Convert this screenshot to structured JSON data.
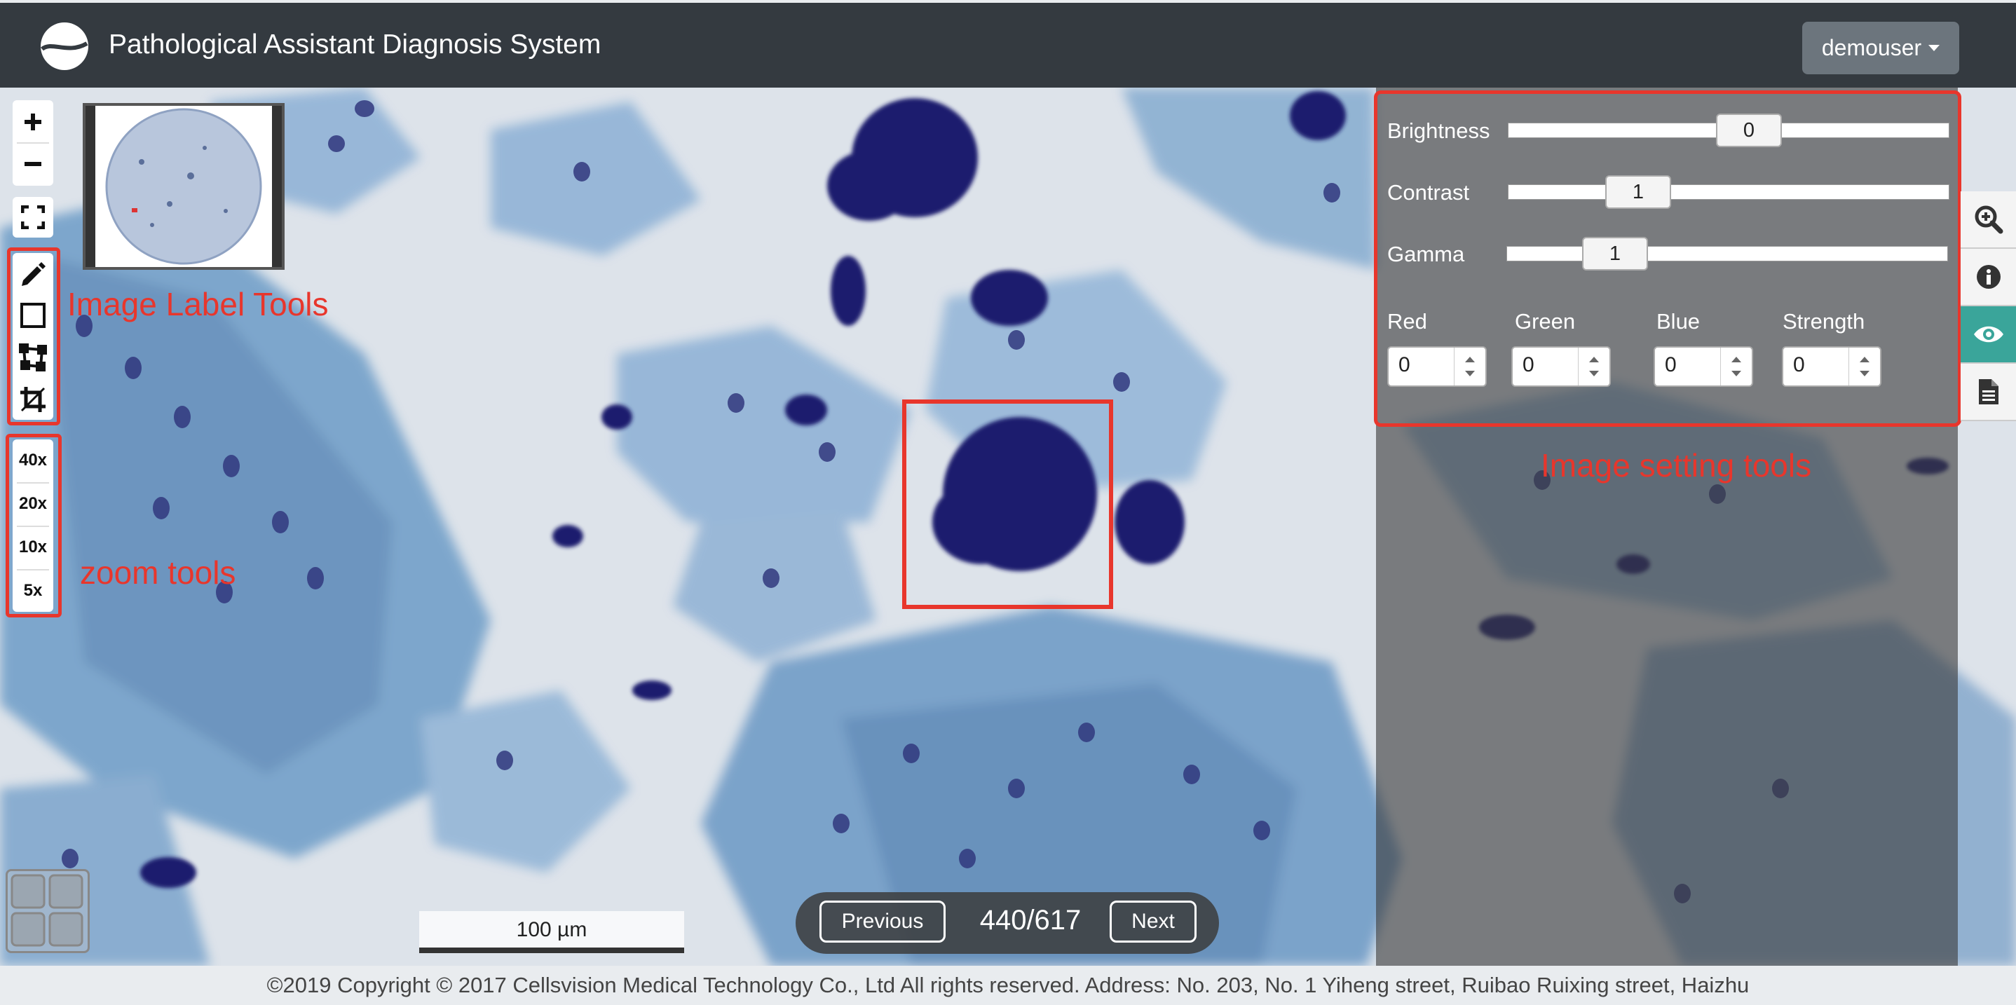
{
  "header": {
    "app_title": "Pathological Assistant Diagnosis System",
    "user_menu_label": "demouser"
  },
  "toolbar": {
    "zoom_in_icon": "plus-icon",
    "zoom_out_icon": "minus-icon",
    "fullscreen_icon": "fullscreen-icon",
    "label_tools": [
      "pencil-icon",
      "rectangle-icon",
      "polygon-icon",
      "crop-icon"
    ],
    "zoom_levels": [
      "40x",
      "20x",
      "10x",
      "5x"
    ]
  },
  "annotations": {
    "label_tools": "Image Label Tools",
    "zoom_tools": "zoom tools",
    "setting_tools": "Image setting tools"
  },
  "settings": {
    "brightness": {
      "label": "Brightness",
      "value": "0"
    },
    "contrast": {
      "label": "Contrast",
      "value": "1"
    },
    "gamma": {
      "label": "Gamma",
      "value": "1"
    },
    "red": {
      "label": "Red",
      "value": "0"
    },
    "green": {
      "label": "Green",
      "value": "0"
    },
    "blue": {
      "label": "Blue",
      "value": "0"
    },
    "strength": {
      "label": "Strength",
      "value": "0"
    }
  },
  "side_panel": {
    "icons": [
      "magnify-plus-icon",
      "info-icon",
      "eye-icon",
      "document-icon"
    ],
    "active": "eye-icon"
  },
  "scalebar": {
    "label": "100 µm"
  },
  "pager": {
    "previous_label": "Previous",
    "next_label": "Next",
    "page_indicator": "440/617"
  },
  "footer": {
    "text": "©2019 Copyright © 2017 Cellsvision Medical Technology Co., Ltd All rights reserved. Address: No. 203, No. 1 Yiheng street, Ruibao Ruixing street, Haizhu"
  },
  "colors": {
    "topbar": "#343a40",
    "annotation_red": "#e8362c",
    "active_side_tab": "#3aa59a",
    "stain_dark": "#1c1e6e",
    "stain_light": "#7fa8cf"
  }
}
